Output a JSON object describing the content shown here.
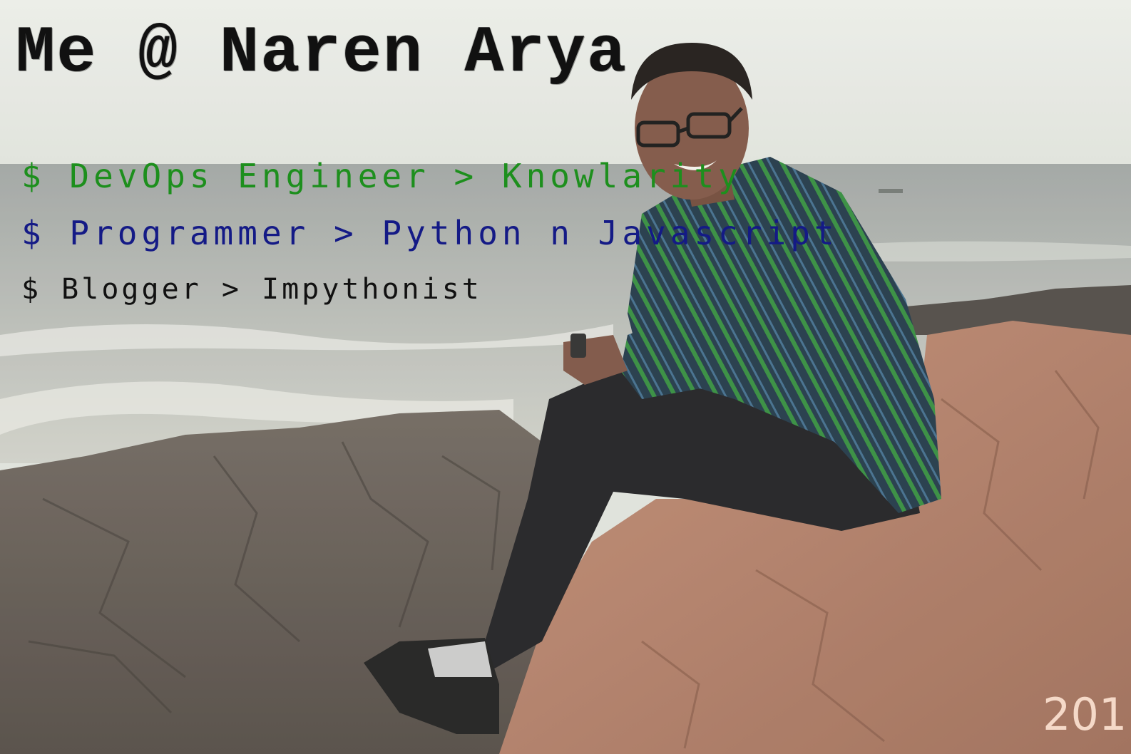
{
  "title": "Me @ Naren Arya",
  "lines": [
    {
      "text": "$ DevOps Engineer > Knowlarity",
      "color": "#1d8f1d"
    },
    {
      "text": "$ Programmer > Python n Javascript",
      "color": "#141a86"
    },
    {
      "text": "$ Blogger > Impythonist",
      "color": "#111111"
    }
  ],
  "year_fragment": "201",
  "palette": {
    "sky": "#e4e7e1",
    "sea": "#a9aea9",
    "rock_dark": "#5e554e",
    "rock_warm": "#b47e66",
    "shirt": "#1e3a4a",
    "jeans": "#1b1b1e"
  }
}
